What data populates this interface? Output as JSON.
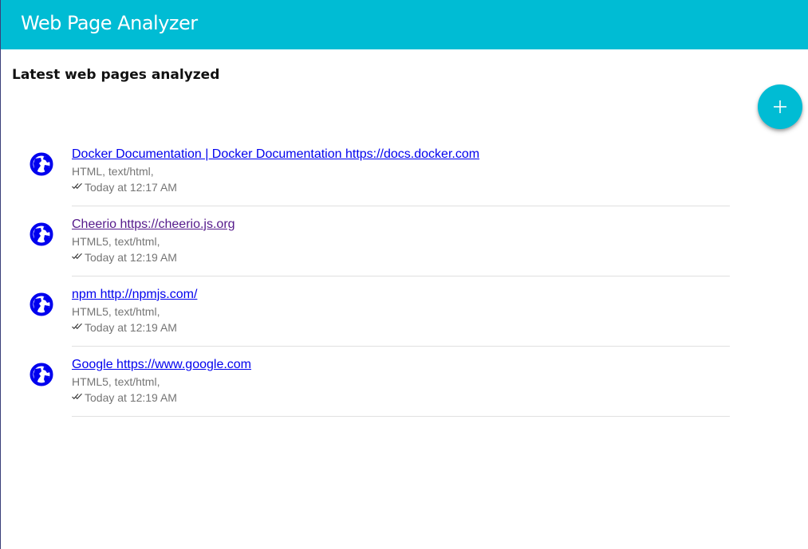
{
  "header": {
    "title": "Web Page Analyzer"
  },
  "main": {
    "heading": "Latest web pages analyzed",
    "add_button_icon": "plus-icon"
  },
  "items": [
    {
      "link": "Docker Documentation | Docker Documentation https://docs.docker.com",
      "meta": "HTML, text/html,",
      "time": "Today at 12:17 AM",
      "visited": false
    },
    {
      "link": "Cheerio https://cheerio.js.org",
      "meta": "HTML5, text/html,",
      "time": "Today at 12:19 AM",
      "visited": true
    },
    {
      "link": "npm http://npmjs.com/",
      "meta": "HTML5, text/html,",
      "time": "Today at 12:19 AM",
      "visited": false
    },
    {
      "link": "Google https://www.google.com",
      "meta": "HTML5, text/html,",
      "time": "Today at 12:19 AM",
      "visited": false
    }
  ],
  "colors": {
    "toolbar": "#00bcd4",
    "link": "#0000ee",
    "link_visited": "#551a8b",
    "globe": "#0000ee",
    "secondary_text": "#757575"
  }
}
